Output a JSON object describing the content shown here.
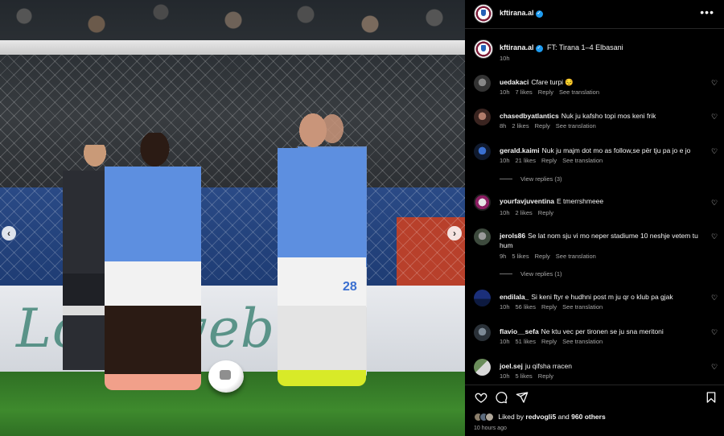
{
  "post": {
    "username": "kftirana.al",
    "more_icon": "more-horizontal-icon",
    "caption": "FT: Tirana 1–4 Elbasani",
    "caption_time": "10h"
  },
  "photo": {
    "ad_text": "Lottoweb",
    "jersey_number": "28",
    "prev_icon": "chevron-left-icon",
    "next_icon": "chevron-right-icon"
  },
  "comments": [
    {
      "user": "uedakaci",
      "text": "Cfare turpi 😔",
      "time": "10h",
      "likes": "7 likes",
      "reply": "Reply",
      "translate": "See translation",
      "view_replies": ""
    },
    {
      "user": "chasedbyatlantics",
      "text": "Nuk ju kafsho topi mos keni frik",
      "time": "8h",
      "likes": "2 likes",
      "reply": "Reply",
      "translate": "See translation",
      "view_replies": ""
    },
    {
      "user": "gerald.kaimi",
      "text": "Nuk ju majm dot mo as follow,se për tju pa jo e jo",
      "time": "10h",
      "likes": "21 likes",
      "reply": "Reply",
      "translate": "See translation",
      "view_replies": "View replies (3)"
    },
    {
      "user": "yourfavjuventina",
      "text": "E tmerrshmeee",
      "time": "10h",
      "likes": "2 likes",
      "reply": "Reply",
      "translate": "",
      "view_replies": ""
    },
    {
      "user": "jerols86",
      "text": "Se lat nom sju vi mo neper stadiume 10 neshje vetem tu hum",
      "time": "9h",
      "likes": "5 likes",
      "reply": "Reply",
      "translate": "See translation",
      "view_replies": "View replies (1)"
    },
    {
      "user": "endilala_",
      "text": "Si keni ftyr e hudhni post m ju qr o klub pa gjak",
      "time": "10h",
      "likes": "56 likes",
      "reply": "Reply",
      "translate": "See translation",
      "view_replies": ""
    },
    {
      "user": "flavio__sefa",
      "text": "Ne ktu vec per tironen se ju sna meritoni",
      "time": "10h",
      "likes": "51 likes",
      "reply": "Reply",
      "translate": "See translation",
      "view_replies": ""
    },
    {
      "user": "joel.sej",
      "text": "ju qifsha rracen",
      "time": "10h",
      "likes": "5 likes",
      "reply": "Reply",
      "translate": "",
      "view_replies": ""
    }
  ],
  "actions": {
    "like_icon": "heart-icon",
    "comment_icon": "comment-icon",
    "share_icon": "send-icon",
    "save_icon": "bookmark-icon"
  },
  "likes": {
    "prefix": "Liked by",
    "user": "redvogli5",
    "and": "and",
    "others": "960 others"
  },
  "posted_ago": "10 hours ago",
  "colors": {
    "background": "#000000",
    "text": "#f5f5f5",
    "secondary": "#a8a8a8",
    "verified": "#1d9bf0"
  }
}
